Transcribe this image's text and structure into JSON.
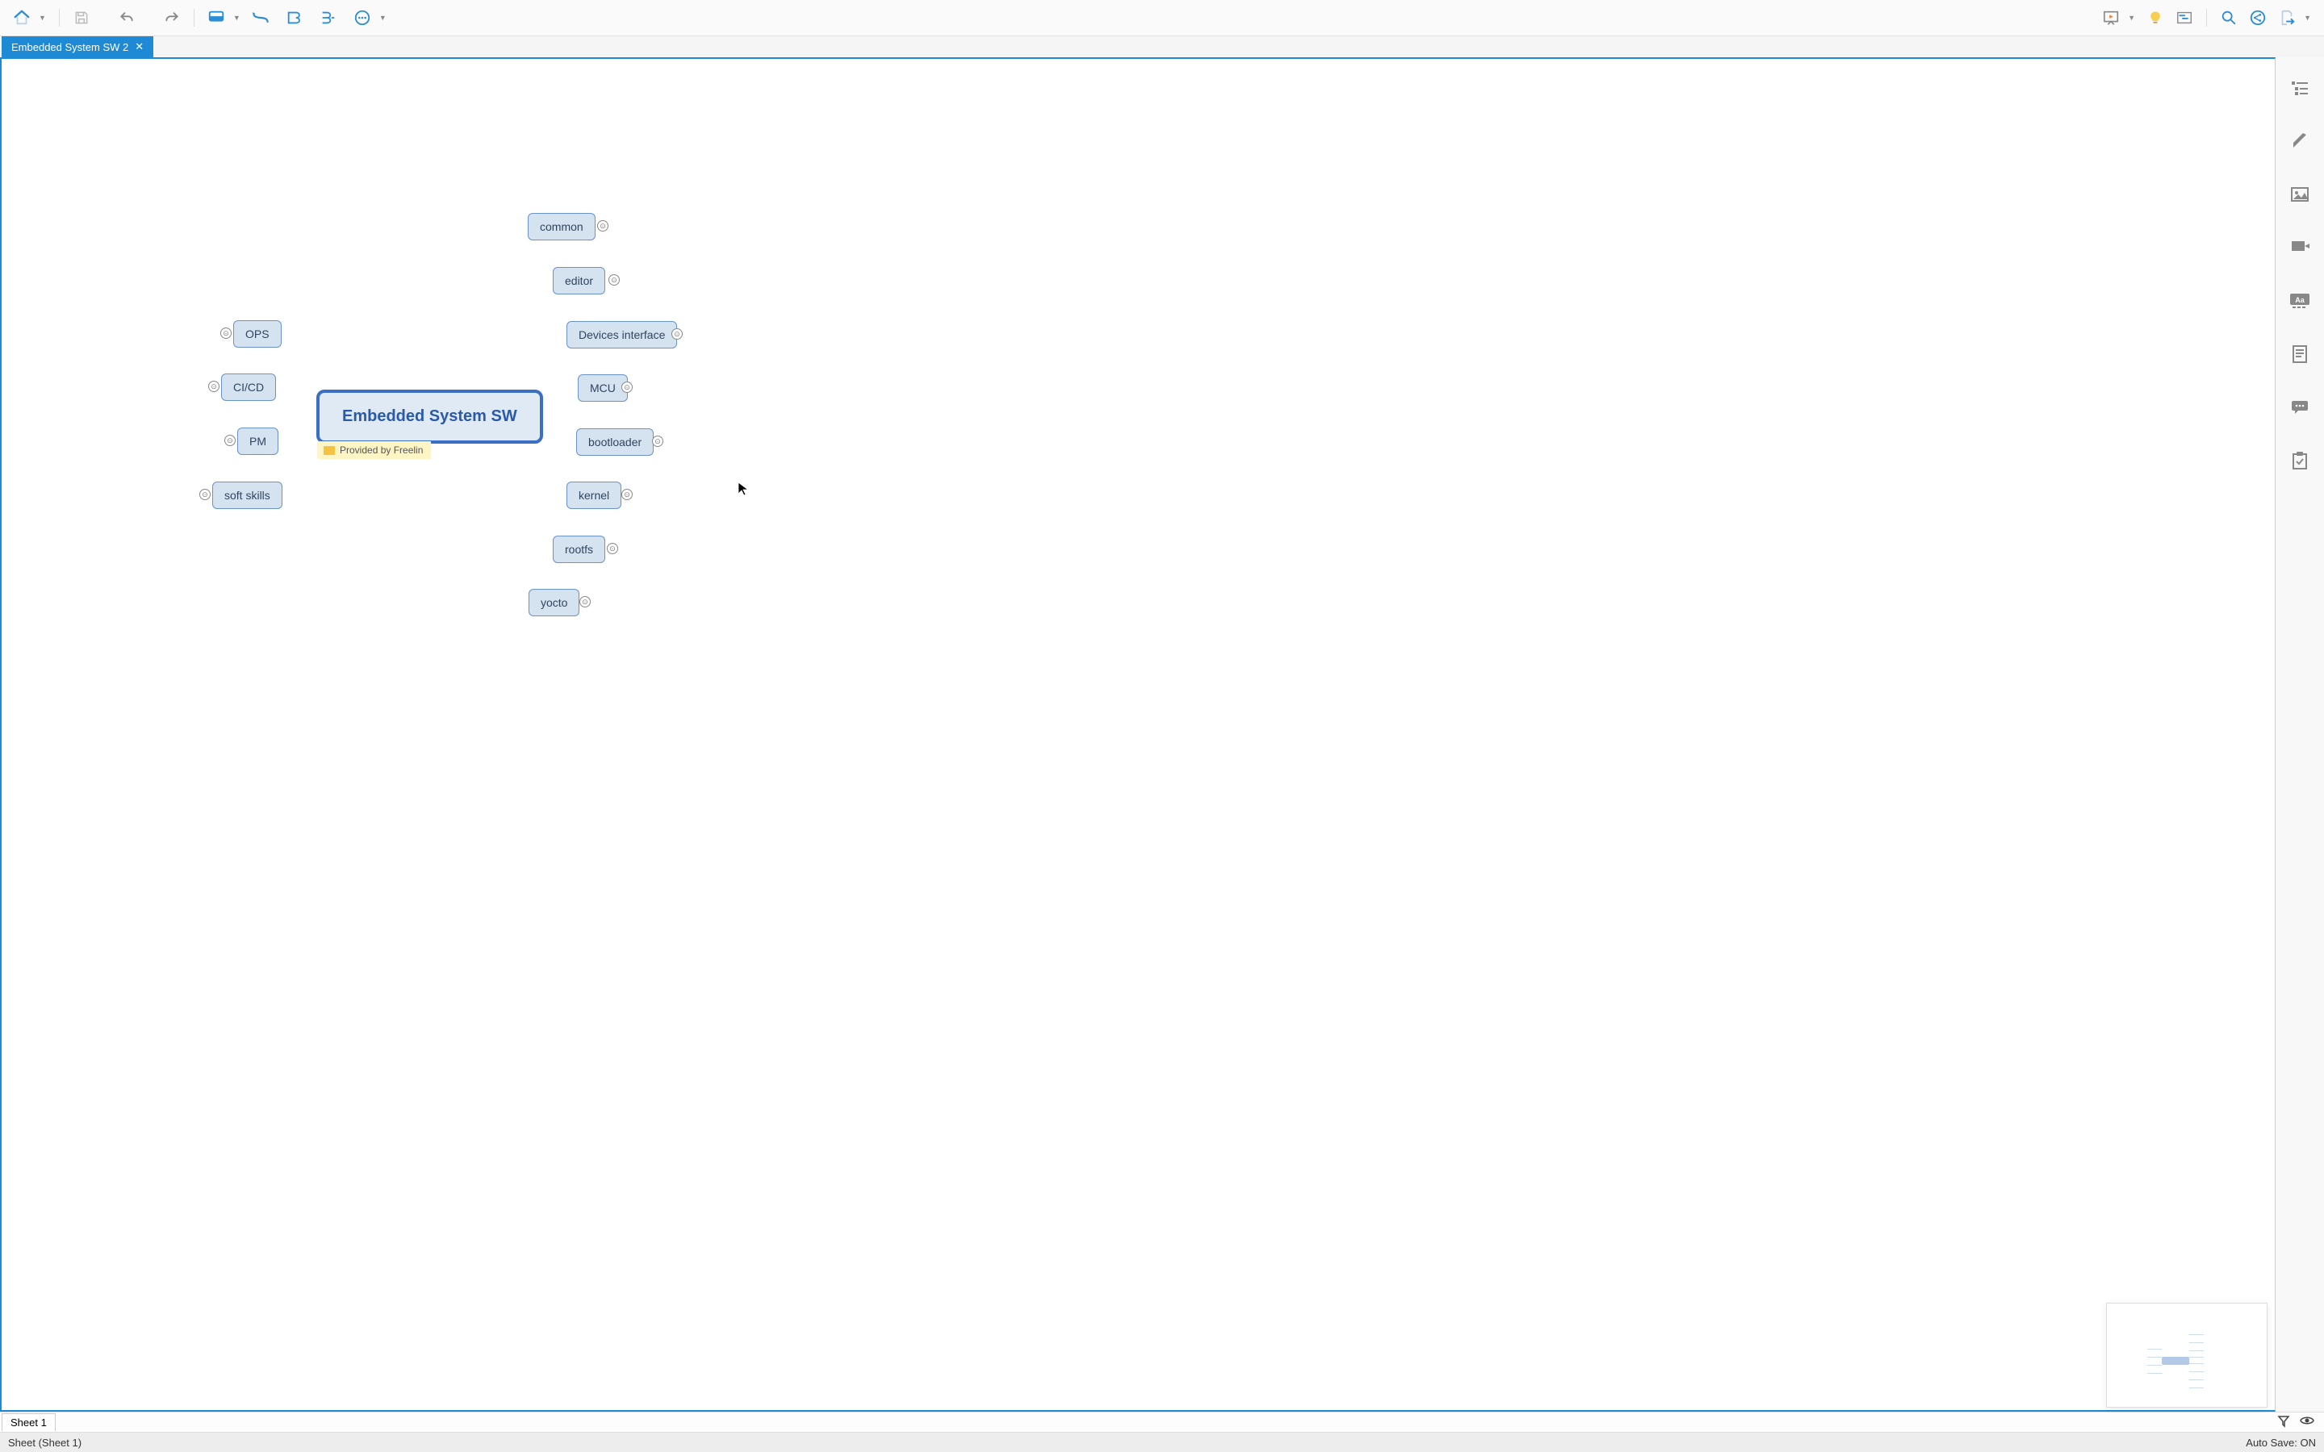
{
  "tab": {
    "title": "Embedded System SW 2"
  },
  "mindmap": {
    "central": "Embedded System SW",
    "note": "Provided by Freelin",
    "left": [
      {
        "label": "OPS"
      },
      {
        "label": "CI/CD"
      },
      {
        "label": "PM"
      },
      {
        "label": "soft skills"
      }
    ],
    "right": [
      {
        "label": "common"
      },
      {
        "label": "editor"
      },
      {
        "label": "Devices interface"
      },
      {
        "label": "MCU"
      },
      {
        "label": "bootloader"
      },
      {
        "label": "kernel"
      },
      {
        "label": "rootfs"
      },
      {
        "label": "yocto"
      }
    ]
  },
  "sheet": {
    "tab": "Sheet 1",
    "title": "Sheet (Sheet 1)"
  },
  "status": {
    "autosave": "Auto Save: ON"
  }
}
